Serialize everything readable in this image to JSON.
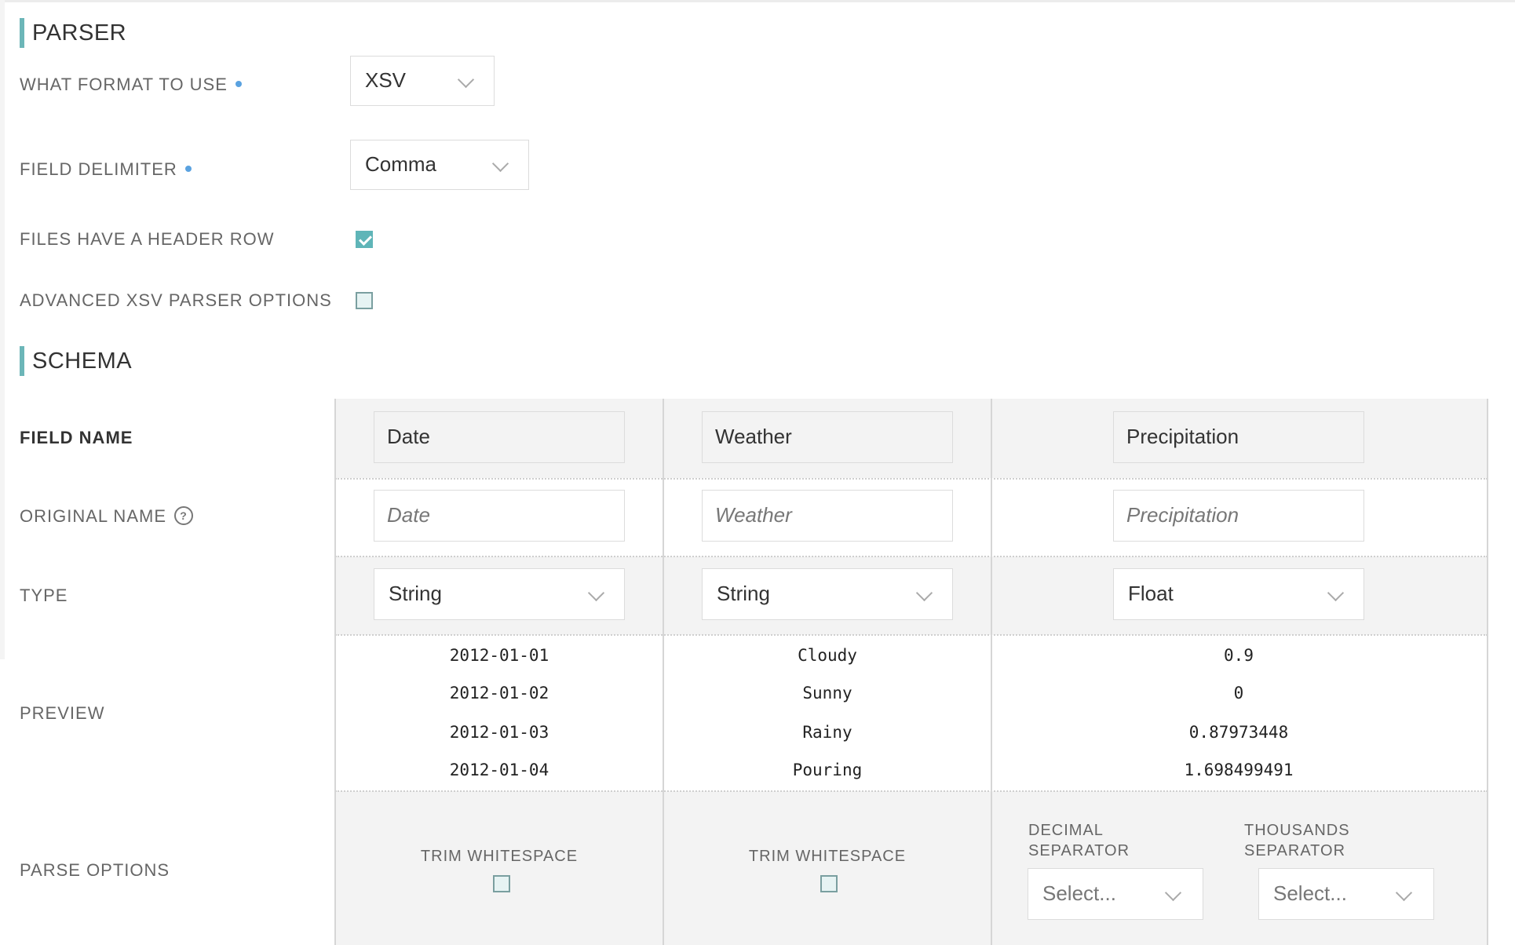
{
  "parser": {
    "title": "PARSER",
    "format": {
      "label": "WHAT FORMAT TO USE",
      "value": "XSV"
    },
    "delimiter": {
      "label": "FIELD DELIMITER",
      "value": "Comma"
    },
    "header_row": {
      "label": "FILES HAVE A HEADER ROW",
      "checked": true
    },
    "advanced": {
      "label": "ADVANCED XSV PARSER OPTIONS",
      "checked": false
    }
  },
  "schema": {
    "title": "SCHEMA",
    "row_labels": {
      "field_name": "FIELD NAME",
      "original_name": "ORIGINAL NAME",
      "type": "TYPE",
      "preview": "PREVIEW",
      "parse_options": "PARSE OPTIONS"
    },
    "columns": [
      {
        "field_name": "Date",
        "original_name_placeholder": "Date",
        "type": "String",
        "preview": [
          "2012-01-01",
          "2012-01-02",
          "2012-01-03",
          "2012-01-04"
        ],
        "trim_label": "TRIM WHITESPACE"
      },
      {
        "field_name": "Weather",
        "original_name_placeholder": "Weather",
        "type": "String",
        "preview": [
          "Cloudy",
          "Sunny",
          "Rainy",
          "Pouring"
        ],
        "trim_label": "TRIM WHITESPACE"
      },
      {
        "field_name": "Precipitation",
        "original_name_placeholder": "Precipitation",
        "type": "Float",
        "preview": [
          "0.9",
          "0",
          "0.87973448",
          "1.698499491"
        ],
        "decimal_label_1": "DECIMAL",
        "decimal_label_2": "SEPARATOR",
        "decimal_value": "Select...",
        "thousands_label_1": "THOUSANDS",
        "thousands_label_2": "SEPARATOR",
        "thousands_value": "Select..."
      }
    ]
  },
  "colors": {
    "accent": "#6cb6b8",
    "required_dot": "#5aa2e0",
    "band": "#f3f3f3"
  }
}
